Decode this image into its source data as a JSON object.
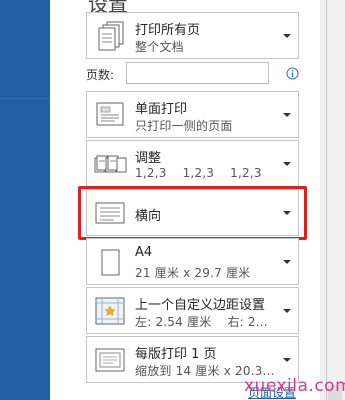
{
  "panel": {
    "heading": "设置"
  },
  "options": {
    "print_range": {
      "title": "打印所有页",
      "subtitle": "整个文档"
    },
    "pages": {
      "label": "页数:",
      "value": ""
    },
    "sides": {
      "title": "单面打印",
      "subtitle": "只打印一侧的页面"
    },
    "collate": {
      "title": "调整",
      "subtitle": "1,2,3    1,2,3    1,2,3"
    },
    "orientation": {
      "title": "横向"
    },
    "paper": {
      "title": "A4",
      "subtitle": "21 厘米 x 29.7 厘米"
    },
    "margins": {
      "title": "上一个自定义边距设置",
      "subtitle": "左: 2.54 厘米    右: 2..."
    },
    "pages_per_sheet": {
      "title": "每版打印 1 页",
      "subtitle": "缩放到 14 厘米 x 20.3..."
    }
  },
  "footer": {
    "page_setup_link": "页面设置",
    "watermark": "xuexila.com"
  },
  "colors": {
    "accent": "#1f5fa4",
    "highlight": "#e0201f",
    "watermark": "#d62e8a"
  },
  "icons": {
    "print_range": "pages-icon",
    "sides": "single-sided-icon",
    "collate": "collated-icon",
    "orientation": "landscape-icon",
    "paper": "paper-size-icon",
    "margins": "custom-margins-icon",
    "pages_per_sheet": "pages-per-sheet-icon",
    "info": "info-icon",
    "dropdown": "dropdown-arrow-icon"
  }
}
